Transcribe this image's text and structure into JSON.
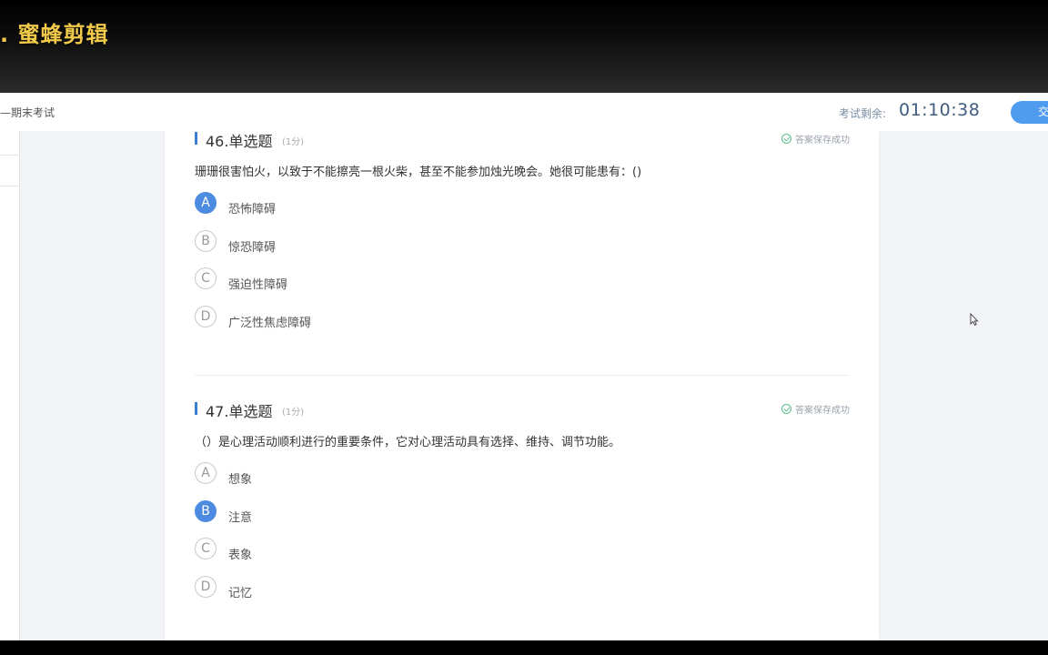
{
  "watermark": ". 蜜蜂剪辑",
  "header": {
    "exam_title": "—期末考试",
    "timer_label": "考试剩余:",
    "timer_value": "01:10:38",
    "submit_label": "交"
  },
  "questions": [
    {
      "title": "46.单选题",
      "score": "(1分)",
      "saved": "答案保存成功",
      "text": "珊珊很害怕火，以致于不能擦亮一根火柴，甚至不能参加烛光晚会。她很可能患有：()",
      "options": [
        {
          "letter": "A",
          "text": "恐怖障碍",
          "selected": true
        },
        {
          "letter": "B",
          "text": "惊恐障碍",
          "selected": false
        },
        {
          "letter": "C",
          "text": "强迫性障碍",
          "selected": false
        },
        {
          "letter": "D",
          "text": "广泛性焦虑障碍",
          "selected": false
        }
      ]
    },
    {
      "title": "47.单选题",
      "score": "(1分)",
      "saved": "答案保存成功",
      "text": "（）是心理活动顺利进行的重要条件，它对心理活动具有选择、维持、调节功能。",
      "options": [
        {
          "letter": "A",
          "text": "想象",
          "selected": false
        },
        {
          "letter": "B",
          "text": "注意",
          "selected": true
        },
        {
          "letter": "C",
          "text": "表象",
          "selected": false
        },
        {
          "letter": "D",
          "text": "记忆",
          "selected": false
        }
      ]
    }
  ],
  "colors": {
    "accent": "#4d8be0",
    "timer": "#3f5c80",
    "watermark": "#f1c94b"
  }
}
